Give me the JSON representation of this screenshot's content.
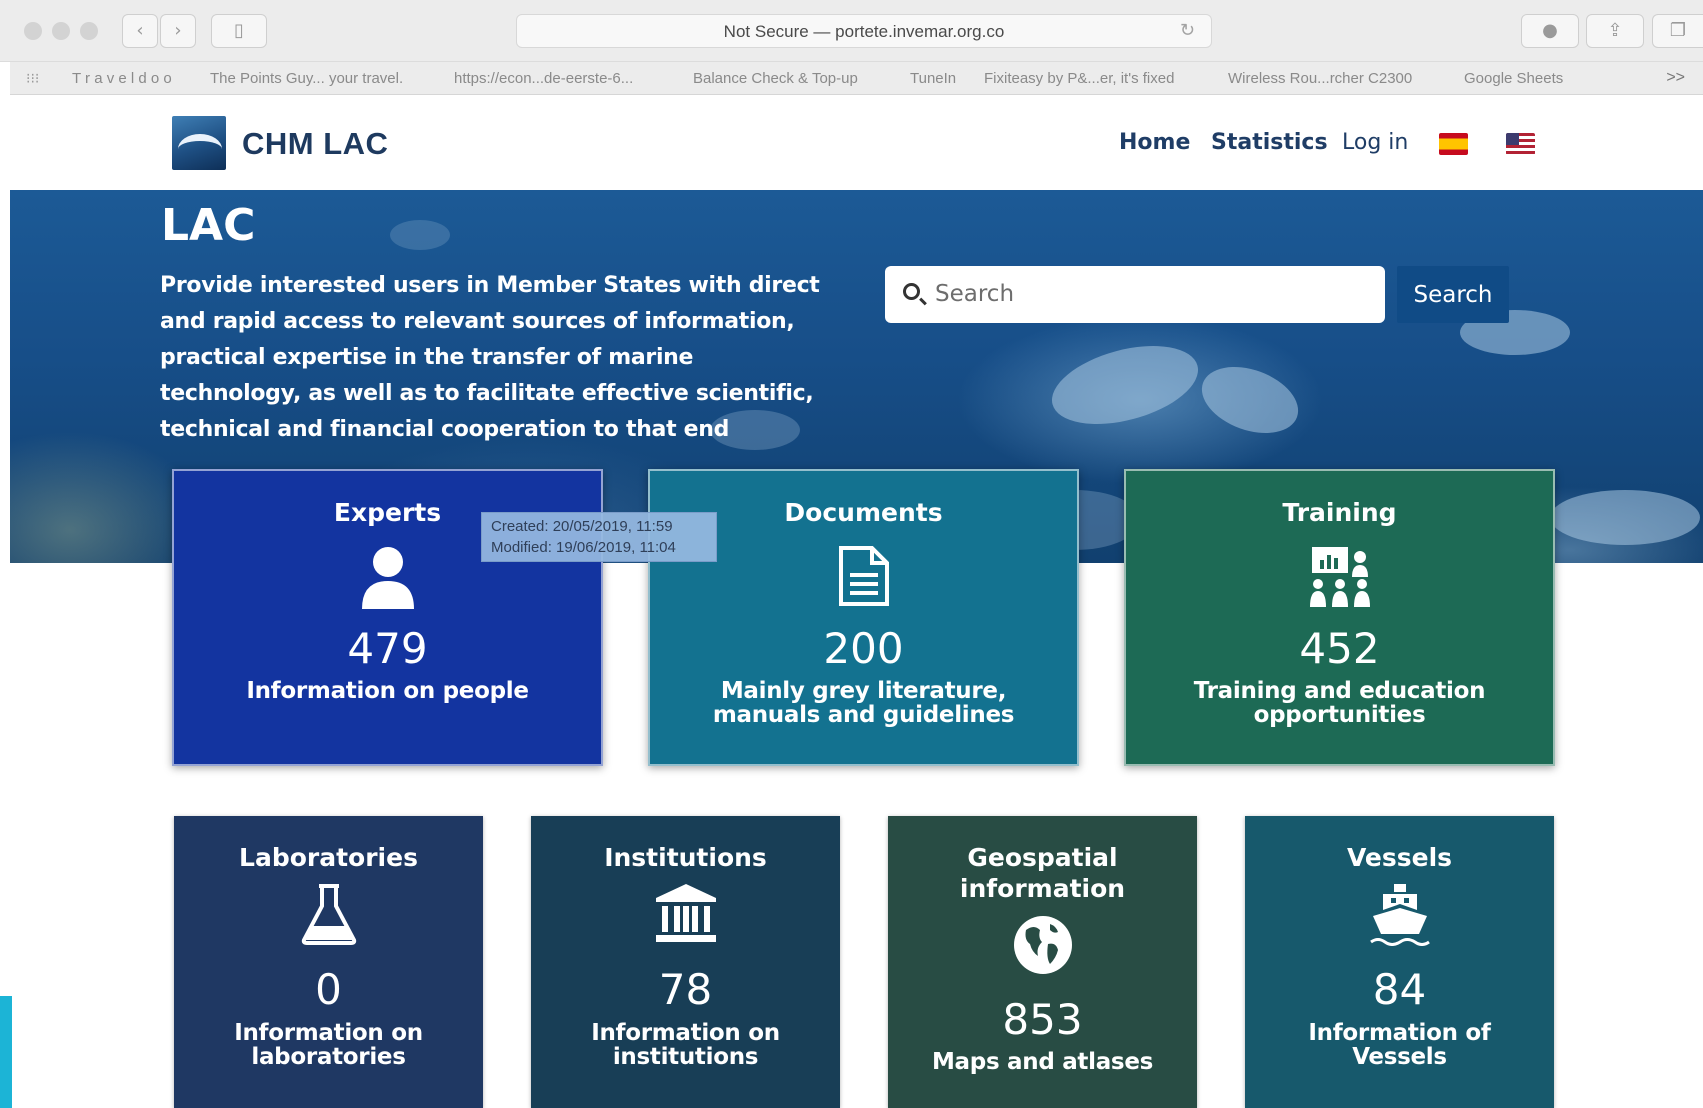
{
  "browser": {
    "address": "Not Secure — portete.invemar.org.co",
    "bookmarks": [
      "T r a v e l d o o",
      "The Points Guy... your travel.",
      "https://econ...de-eerste-6...",
      "Balance Check & Top-up",
      "TuneIn",
      "Fixiteasy by P&...er, it's fixed",
      "Wireless Rou...rcher C2300",
      "Google Sheets"
    ],
    "more": ">>"
  },
  "header": {
    "brand": "CHM LAC",
    "nav": {
      "home": "Home",
      "statistics": "Statistics",
      "login": "Log in"
    }
  },
  "hero": {
    "title": "LAC",
    "description": "Provide interested users in Member States with direct and rapid access to relevant sources of information, practical expertise in the transfer of marine technology, as well as to facilitate effective scientific, technical and financial cooperation to that end",
    "search_placeholder": "Search",
    "search_button": "Search"
  },
  "tooltip": {
    "created": "Created: 20/05/2019, 11:59",
    "modified": "Modified: 19/06/2019, 11:04"
  },
  "cards": [
    {
      "title": "Experts",
      "count": "479",
      "description": "Information on people",
      "icon": "person-icon",
      "color": "#1334a0"
    },
    {
      "title": "Documents",
      "count": "200",
      "description": "Mainly grey literature, manuals and guidelines",
      "icon": "document-icon",
      "color": "#137290"
    },
    {
      "title": "Training",
      "count": "452",
      "description": "Training and education opportunities",
      "icon": "training-icon",
      "color": "#1d6a55"
    },
    {
      "title": "Laboratories",
      "count": "0",
      "description": "Information on laboratories",
      "icon": "flask-icon",
      "color": "#1f3863"
    },
    {
      "title": "Institutions",
      "count": "78",
      "description": "Information on institutions",
      "icon": "institution-icon",
      "color": "#183e56"
    },
    {
      "title": "Geospatial information",
      "count": "853",
      "description": "Maps and atlases",
      "icon": "globe-icon",
      "color": "#284c44"
    },
    {
      "title": "Vessels",
      "count": "84",
      "description": "Information of Vessels",
      "icon": "ship-icon",
      "color": "#17596c"
    }
  ]
}
